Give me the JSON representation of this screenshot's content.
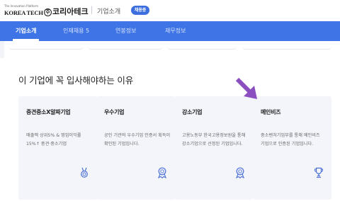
{
  "header": {
    "logo_sub": "The Innovation Platform",
    "logo_main": "KOREA TECH",
    "company_circ": "주",
    "company_name": "코리아테크",
    "section_title": "기업소개",
    "hiring_badge": "채용중"
  },
  "tabs": [
    {
      "label": "기업소개",
      "active": true
    },
    {
      "label": "인재채용 5",
      "active": false
    },
    {
      "label": "연봉정보",
      "active": false
    },
    {
      "label": "재무정보",
      "active": false
    }
  ],
  "main": {
    "heading": "이 기업에 꼭 입사해야하는 이유",
    "cards": [
      {
        "title": "중견중소X알짜기업",
        "desc": "매출액 상위5% & 영업이익률 15%↑ 중견·중소기업",
        "icon": "medal-icon"
      },
      {
        "title": "우수기업",
        "desc": "공인 기관의 우수기업 인증서 획득이 확인된 기업입니다.",
        "icon": "award-ribbon-icon"
      },
      {
        "title": "강소기업",
        "desc": "고용노동부 한국고용정보원을 통해 강소기업으로 선정된 기업입니다.",
        "icon": "award-ribbon-icon"
      },
      {
        "title": "메인비즈",
        "desc": "중소벤처기업부를 통해 메인비즈 기업으로 인증된 기업입니다.",
        "icon": "trophy-icon"
      }
    ]
  },
  "colors": {
    "tab_bar": "#3f74e6",
    "badge": "#3c6ee0",
    "icon_blue": "#4a6fd6",
    "arrow_purple": "#8b4fbf"
  }
}
